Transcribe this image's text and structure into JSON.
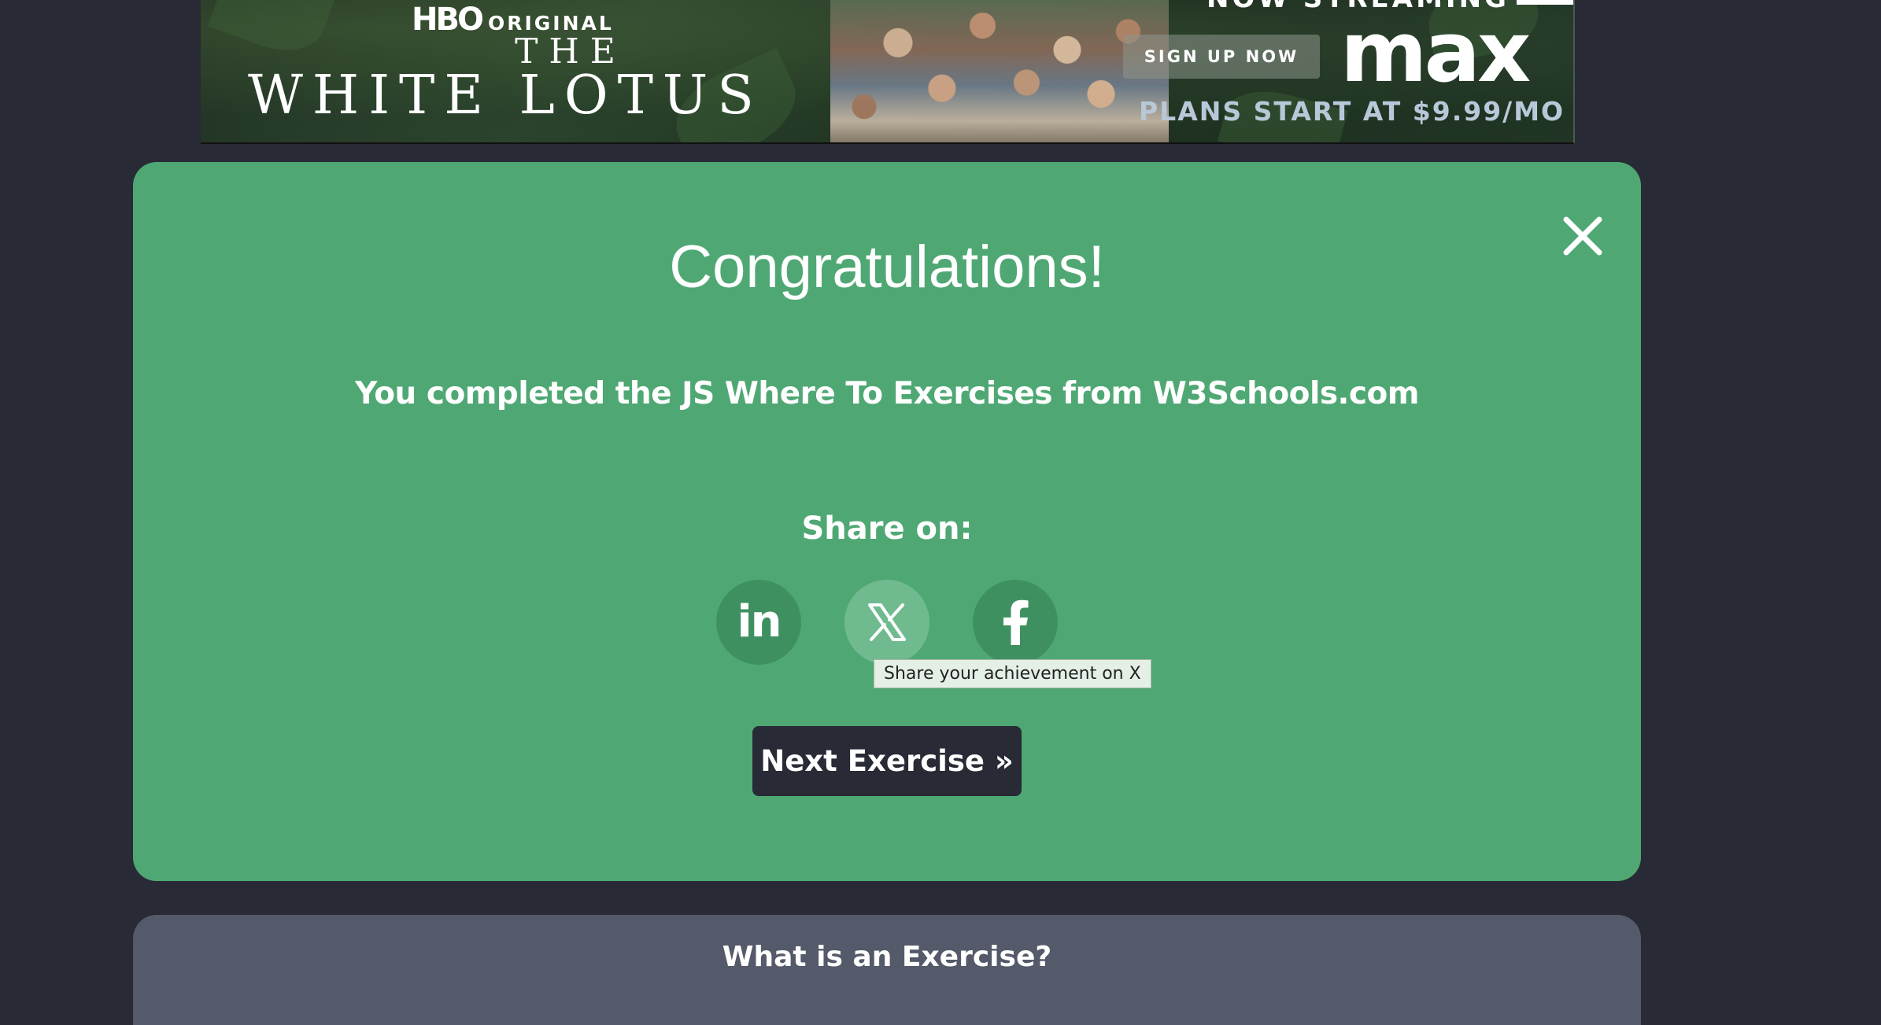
{
  "ad": {
    "hbo_logo": "HBO",
    "hbo_label": "ORIGINAL",
    "show_the": "THE",
    "show_name": "WHITE LOTUS",
    "now_streaming": "NOW STREAMING",
    "signup_label": "SIGN UP NOW",
    "brand": "max",
    "plans": "PLANS START AT $9.99/MO"
  },
  "modal": {
    "title": "Congratulations!",
    "message": "You completed the JS Where To Exercises from W3Schools.com",
    "share_label": "Share on:",
    "share_buttons": [
      {
        "name": "LinkedIn",
        "icon": "linkedin-icon",
        "glyph": "in"
      },
      {
        "name": "X",
        "icon": "x-icon"
      },
      {
        "name": "Facebook",
        "icon": "facebook-icon"
      }
    ],
    "tooltip": "Share your achievement on X",
    "next_label": "Next Exercise »",
    "close_icon": "close-icon"
  },
  "info": {
    "title": "What is an Exercise?"
  },
  "colors": {
    "page_bg": "#282a35",
    "modal_bg": "#4fa874",
    "share_btn_bg": "#3f9060",
    "share_btn_hover_bg": "#6fbb8f",
    "next_btn_bg": "#282a35",
    "info_bg": "#555a6a"
  }
}
